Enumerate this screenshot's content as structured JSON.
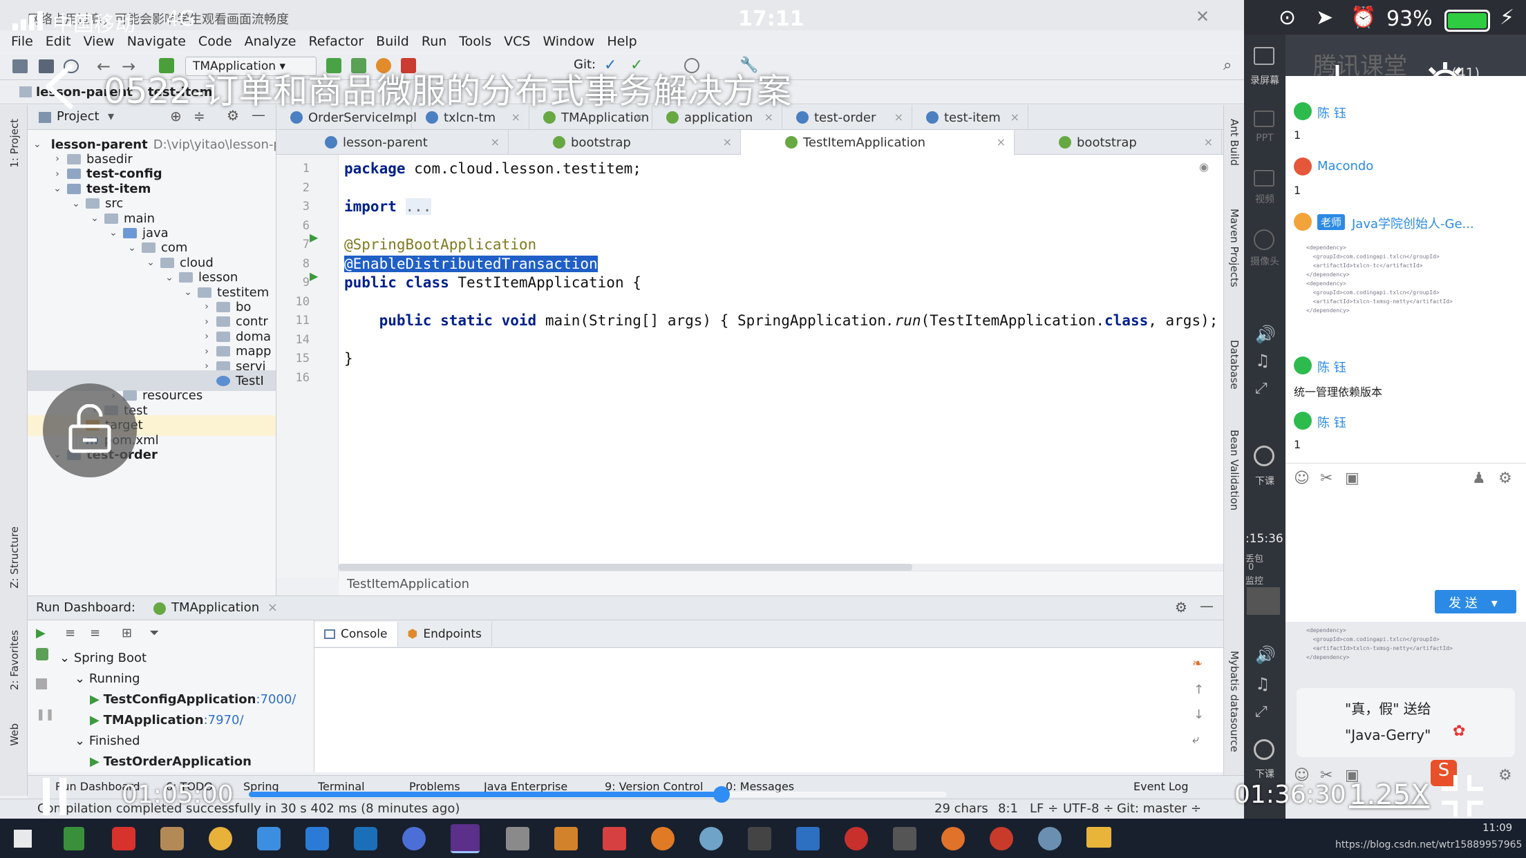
{
  "phone_status": {
    "carrier": "中国移动",
    "network": "4G",
    "time": "17:11",
    "battery": "93%"
  },
  "notice": "网络占用过高，可能会影响学生观看画面流畅度",
  "video": {
    "title": "0522-订单和商品微服的分布式事务解决方案",
    "current_time": "01:05:00",
    "total_time": "01:36:30",
    "speed": "1.25X",
    "progress_fraction": 0.677
  },
  "ide": {
    "menu": [
      "File",
      "Edit",
      "View",
      "Navigate",
      "Code",
      "Analyze",
      "Refactor",
      "Build",
      "Run",
      "Tools",
      "VCS",
      "Window",
      "Help"
    ],
    "run_config": "TMApplication",
    "git_label": "Git:",
    "nav_path": [
      "lesson-parent",
      "test-item"
    ],
    "project_panel": {
      "title": "Project",
      "tree": [
        {
          "label": "lesson-parent",
          "path": "D:\\vip\\yitao\\lesson-p",
          "indent": 0,
          "bold": true,
          "expanded": true
        },
        {
          "label": "basedir",
          "indent": 1,
          "expanded": false
        },
        {
          "label": "test-config",
          "indent": 1,
          "bold": true,
          "expanded": false
        },
        {
          "label": "test-item",
          "indent": 1,
          "bold": true,
          "expanded": true
        },
        {
          "label": "src",
          "indent": 2,
          "expanded": true
        },
        {
          "label": "main",
          "indent": 3,
          "expanded": true
        },
        {
          "label": "java",
          "indent": 4,
          "expanded": true
        },
        {
          "label": "com",
          "indent": 5,
          "expanded": true
        },
        {
          "label": "cloud",
          "indent": 6,
          "expanded": true
        },
        {
          "label": "lesson",
          "indent": 7,
          "expanded": true
        },
        {
          "label": "testitem",
          "indent": 8,
          "expanded": true
        },
        {
          "label": "bo",
          "indent": 9,
          "expanded": false
        },
        {
          "label": "contr",
          "indent": 9,
          "expanded": false
        },
        {
          "label": "doma",
          "indent": 9,
          "expanded": false
        },
        {
          "label": "mapp",
          "indent": 9,
          "expanded": false
        },
        {
          "label": "servi",
          "indent": 9,
          "expanded": false
        },
        {
          "label": "TestI",
          "indent": 9,
          "selected": true
        },
        {
          "label": "resources",
          "indent": 4,
          "expanded": false
        },
        {
          "label": "test",
          "indent": 3,
          "expanded": false
        },
        {
          "label": "target",
          "indent": 2,
          "expanded": false,
          "highlight": true
        },
        {
          "label": "pom.xml",
          "indent": 2
        },
        {
          "label": "test-order",
          "indent": 1,
          "bold": true,
          "expanded": true
        }
      ]
    },
    "tabs_row1": [
      "OrderServiceImpl",
      "txlcn-tm",
      "TMApplication",
      "application",
      "test-order",
      "test-item"
    ],
    "tabs_row2": [
      "lesson-parent",
      "bootstrap",
      "TestItemApplication",
      "bootstrap"
    ],
    "active_tab": "TestItemApplication",
    "code_lines": [
      {
        "num": "1",
        "text": "package com.cloud.lesson.testitem;"
      },
      {
        "num": "2",
        "text": ""
      },
      {
        "num": "3",
        "text": "import ..."
      },
      {
        "num": "6",
        "text": ""
      },
      {
        "num": "7",
        "text": "@SpringBootApplication"
      },
      {
        "num": "8",
        "text": "@EnableDistributedTransaction"
      },
      {
        "num": "9",
        "text": "public class TestItemApplication {"
      },
      {
        "num": "10",
        "text": ""
      },
      {
        "num": "11",
        "text": "    public static void main(String[] args) { SpringApplication.run(TestItemApplication.class, args); }"
      },
      {
        "num": "14",
        "text": ""
      },
      {
        "num": "15",
        "text": "}"
      },
      {
        "num": "16",
        "text": ""
      }
    ],
    "editor_breadcrumb": "TestItemApplication",
    "run_dashboard": {
      "title": "Run Dashboard:",
      "config_tab": "TMApplication",
      "tree": [
        {
          "label": "Spring Boot",
          "indent": 0
        },
        {
          "label": "Running",
          "indent": 1
        },
        {
          "label": "TestConfigApplication",
          "port": ":7000/",
          "indent": 2
        },
        {
          "label": "TMApplication",
          "port": ":7970/",
          "indent": 2
        },
        {
          "label": "Finished",
          "indent": 1
        },
        {
          "label": "TestOrderApplication",
          "indent": 2
        }
      ],
      "console_tabs": [
        "Console",
        "Endpoints"
      ]
    },
    "bottom_tools": [
      "Run Dashboard",
      "6: TODO",
      "Spring",
      "Terminal",
      "Problems",
      "Java Enterprise",
      "9: Version Control",
      "0: Messages",
      "Event Log"
    ],
    "status": {
      "message": "Compilation completed successfully in 30 s 402 ms (8 minutes ago)",
      "chars": "29 chars",
      "position": "8:1",
      "line_sep": "LF ÷",
      "encoding": "UTF-8 ÷",
      "git": "Git: master ÷"
    },
    "left_strip": [
      "1: Project",
      "Z: Structure",
      "2: Favorites",
      "Web"
    ],
    "right_strip": [
      "Ant Build",
      "Maven Projects",
      "Database",
      "Bean Validation",
      "Mybatis datasource"
    ]
  },
  "chat": {
    "watermark": "腾讯课堂",
    "count": "(41)",
    "side_labels": [
      "录屏幕",
      "PPT",
      "视频",
      "摄像头",
      "下课",
      "下课"
    ],
    "side_time": ":15:36",
    "side_lost": "丢包",
    "side_lost_value": "0",
    "side_monitor": "监控",
    "messages": [
      {
        "name": "陈 钰",
        "text": "1"
      },
      {
        "name": "Macondo",
        "text": "1"
      },
      {
        "name": "Java学院创始人-Ge...",
        "badge": "老师",
        "text": ""
      },
      {
        "name": "陈 钰",
        "text": "统一管理依赖版本"
      },
      {
        "name": "陈 钰",
        "text": "1"
      }
    ],
    "send_button": "发 送",
    "gift_line1": "\"真，假\" 送给",
    "gift_line2": "\"Java-Gerry\"",
    "clock": "11:09",
    "url": "https://blog.csdn.net/wtr15889957965"
  },
  "colors": {
    "accent": "#2f8df5",
    "selection": "#1f5fc6",
    "annotation": "#7f7a1f",
    "keyword": "#001f8a",
    "chat_name": "#2b8ae6",
    "battery": "#2ecc40"
  }
}
